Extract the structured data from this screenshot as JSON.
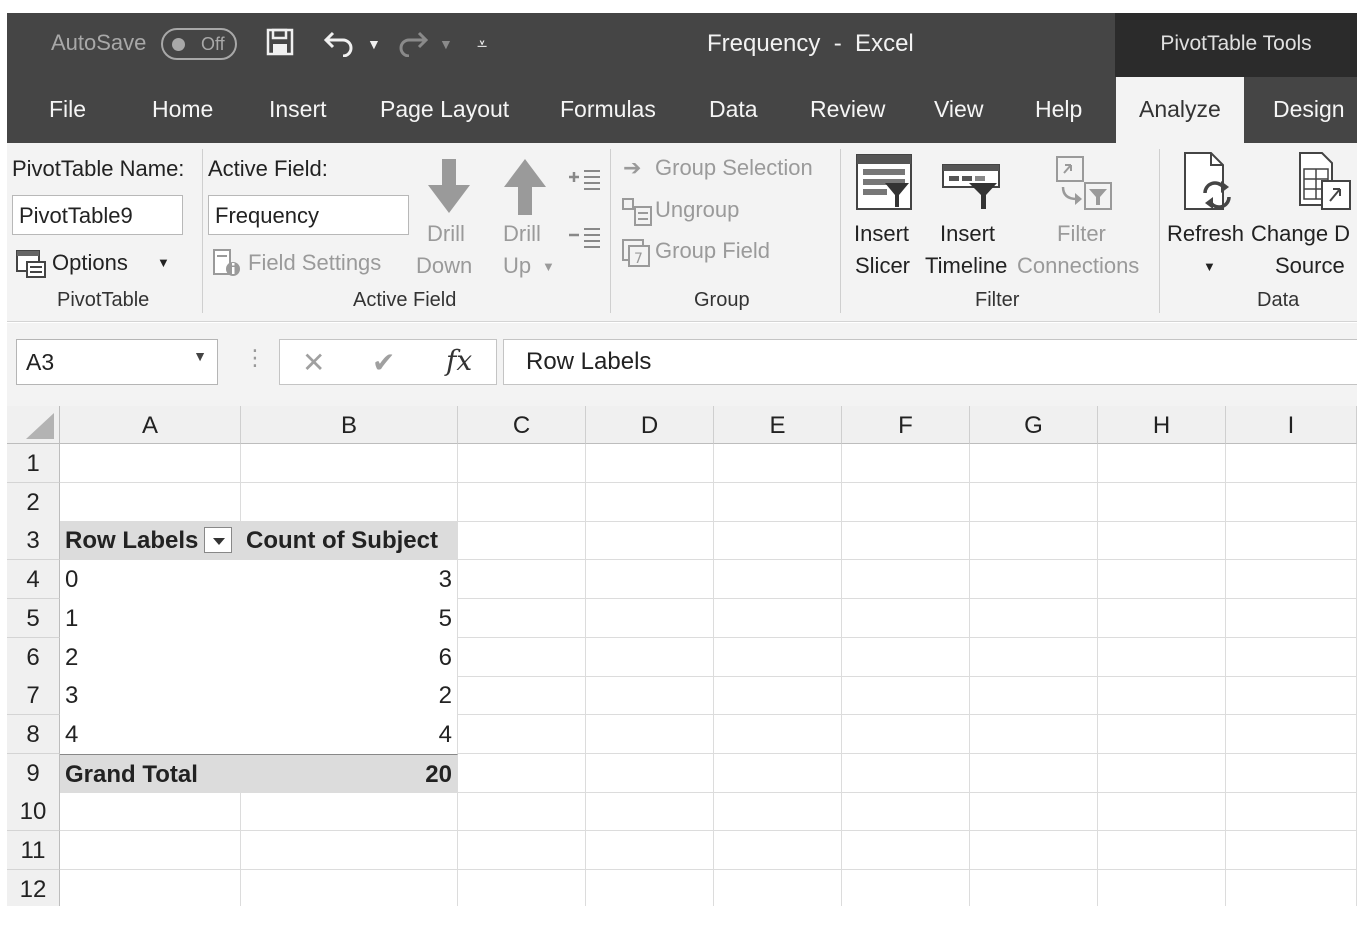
{
  "window": {
    "autosave_label": "AutoSave",
    "autosave_state": "Off",
    "title": "Frequency  -  Excel",
    "context_tools": "PivotTable Tools"
  },
  "tabs": [
    "File",
    "Home",
    "Insert",
    "Page Layout",
    "Formulas",
    "Data",
    "Review",
    "View",
    "Help",
    "Analyze",
    "Design"
  ],
  "active_tab": "Analyze",
  "ribbon": {
    "pivottable": {
      "name_label": "PivotTable Name:",
      "name_value": "PivotTable9",
      "options_label": "Options",
      "group_label": "PivotTable"
    },
    "active_field": {
      "label": "Active Field:",
      "value": "Frequency",
      "field_settings": "Field Settings",
      "drill_down_1": "Drill",
      "drill_down_2": "Down",
      "drill_up_1": "Drill",
      "drill_up_2": "Up",
      "group_label": "Active Field"
    },
    "group": {
      "group_selection": "Group Selection",
      "ungroup": "Ungroup",
      "group_field": "Group Field",
      "group_label": "Group"
    },
    "filter": {
      "insert_slicer_1": "Insert",
      "insert_slicer_2": "Slicer",
      "insert_timeline_1": "Insert",
      "insert_timeline_2": "Timeline",
      "filter_connections_1": "Filter",
      "filter_connections_2": "Connections",
      "group_label": "Filter"
    },
    "data": {
      "refresh": "Refresh",
      "change_source_1": "Change D",
      "change_source_2": "Source",
      "group_label": "Data"
    }
  },
  "formula_bar": {
    "name_box": "A3",
    "fx": "fx",
    "formula": "Row Labels"
  },
  "columns": [
    "A",
    "B",
    "C",
    "D",
    "E",
    "F",
    "G",
    "H",
    "I"
  ],
  "rows": [
    "1",
    "2",
    "3",
    "4",
    "5",
    "6",
    "7",
    "8",
    "9",
    "10",
    "11",
    "12"
  ],
  "pivot": {
    "header_row_labels": "Row Labels",
    "header_count": "Count of Subject",
    "items": [
      {
        "label": "0",
        "count": "3"
      },
      {
        "label": "1",
        "count": "5"
      },
      {
        "label": "2",
        "count": "6"
      },
      {
        "label": "3",
        "count": "2"
      },
      {
        "label": "4",
        "count": "4"
      }
    ],
    "total_label": "Grand Total",
    "total_value": "20"
  },
  "colors": {
    "title_bar": "#454545",
    "context_bar": "#2b2b2b",
    "ribbon": "#f3f3f3",
    "pivot_band": "#dcdcdc"
  }
}
